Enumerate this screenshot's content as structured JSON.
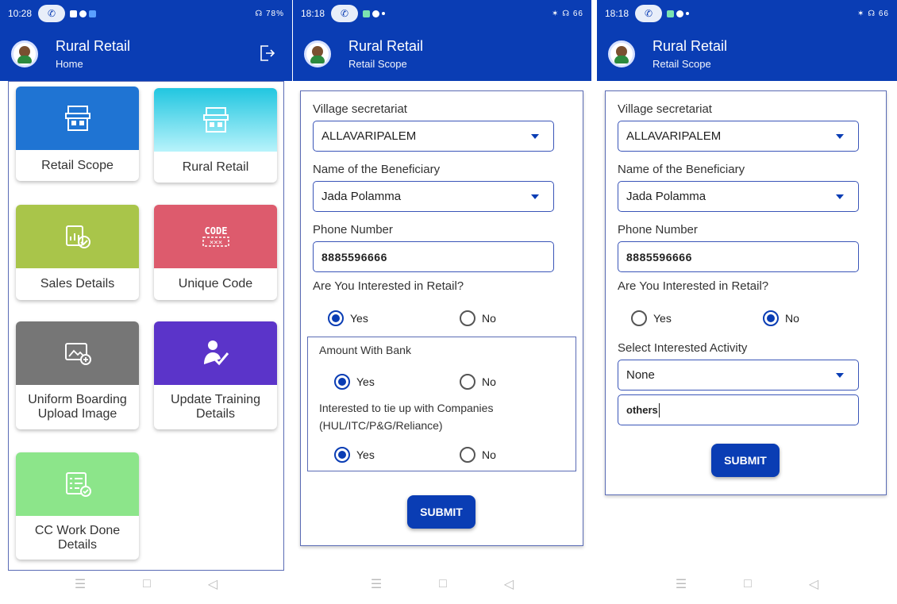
{
  "screens": [
    {
      "status": {
        "time": "10:28",
        "right": "☊ 78%"
      },
      "appbar": {
        "title": "Rural Retail",
        "subtitle": "Home"
      },
      "tiles": [
        {
          "label": "Retail Scope",
          "color": "#1f74d3",
          "icon": "shop-icon"
        },
        {
          "label": "Rural Retail",
          "color": "#21c6e0",
          "icon": "shop-icon"
        },
        {
          "label": "Sales Details",
          "color": "#a9c54a",
          "icon": "sales-report-icon"
        },
        {
          "label": "Unique Code",
          "color": "#dd5b6d",
          "icon": "code-icon"
        },
        {
          "label": "Uniform Boarding Upload Image",
          "color": "#767676",
          "icon": "upload-image-icon"
        },
        {
          "label": "Update Training Details",
          "color": "#5b34c9",
          "icon": "training-icon"
        },
        {
          "label": "CC Work Done Details",
          "color": "#8ce58a",
          "icon": "checklist-icon"
        }
      ]
    },
    {
      "status": {
        "time": "18:18",
        "right": "✶ ☊ 66"
      },
      "appbar": {
        "title": "Rural Retail",
        "subtitle": "Retail Scope"
      },
      "labels": {
        "village": "Village secretariat",
        "beneficiary": "Name of the Beneficiary",
        "phone": "Phone Number",
        "interested": "Are You Interested in Retail?",
        "amount": "Amount With Bank",
        "tieup": "Interested to tie up with Companies (HUL/ITC/P&G/Reliance)"
      },
      "values": {
        "village": "ALLAVARIPALEM",
        "beneficiary": "Jada Polamma",
        "phone": "8885596666"
      },
      "radios": {
        "yes": "Yes",
        "no": "No"
      },
      "submit": "SUBMIT"
    },
    {
      "status": {
        "time": "18:18",
        "right": "✶ ☊ 66"
      },
      "appbar": {
        "title": "Rural Retail",
        "subtitle": "Retail Scope"
      },
      "labels": {
        "village": "Village secretariat",
        "beneficiary": "Name of the Beneficiary",
        "phone": "Phone Number",
        "interested": "Are You Interested in Retail?",
        "activity": "Select Interested Activity"
      },
      "values": {
        "village": "ALLAVARIPALEM",
        "beneficiary": "Jada Polamma",
        "phone": "8885596666",
        "activity": "None",
        "other": "others"
      },
      "radios": {
        "yes": "Yes",
        "no": "No"
      },
      "submit": "SUBMIT"
    }
  ]
}
